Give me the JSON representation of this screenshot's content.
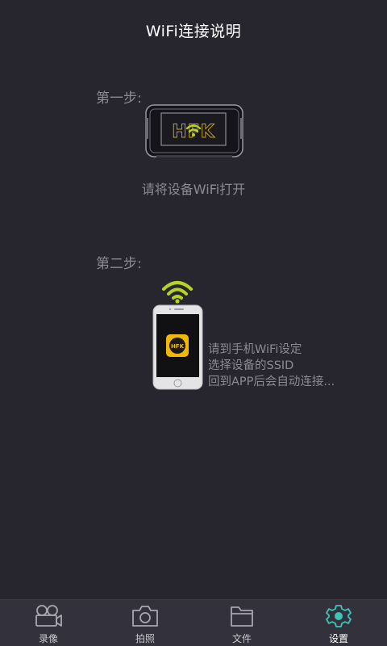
{
  "header": {
    "title": "WiFi连接说明"
  },
  "step1": {
    "label": "第一步:",
    "caption": "请将设备WiFi打开",
    "device_logo": "HFK"
  },
  "step2": {
    "label": "第二步:",
    "app_logo": "HFK",
    "lines": [
      "请到手机WiFi设定",
      "选择设备的SSID",
      "回到APP后会自动连接..."
    ]
  },
  "tabbar": {
    "active_index": 3,
    "tabs": [
      {
        "label": "录像",
        "icon": "video-camera-icon"
      },
      {
        "label": "拍照",
        "icon": "photo-camera-icon"
      },
      {
        "label": "文件",
        "icon": "folder-icon"
      },
      {
        "label": "设置",
        "icon": "gear-icon"
      }
    ]
  },
  "colors": {
    "background": "#27262f",
    "tabbar": "#33323c",
    "accent_wifi": "#b5d420",
    "accent_active": "#3fc4b8",
    "text_muted": "#8b8a92"
  }
}
